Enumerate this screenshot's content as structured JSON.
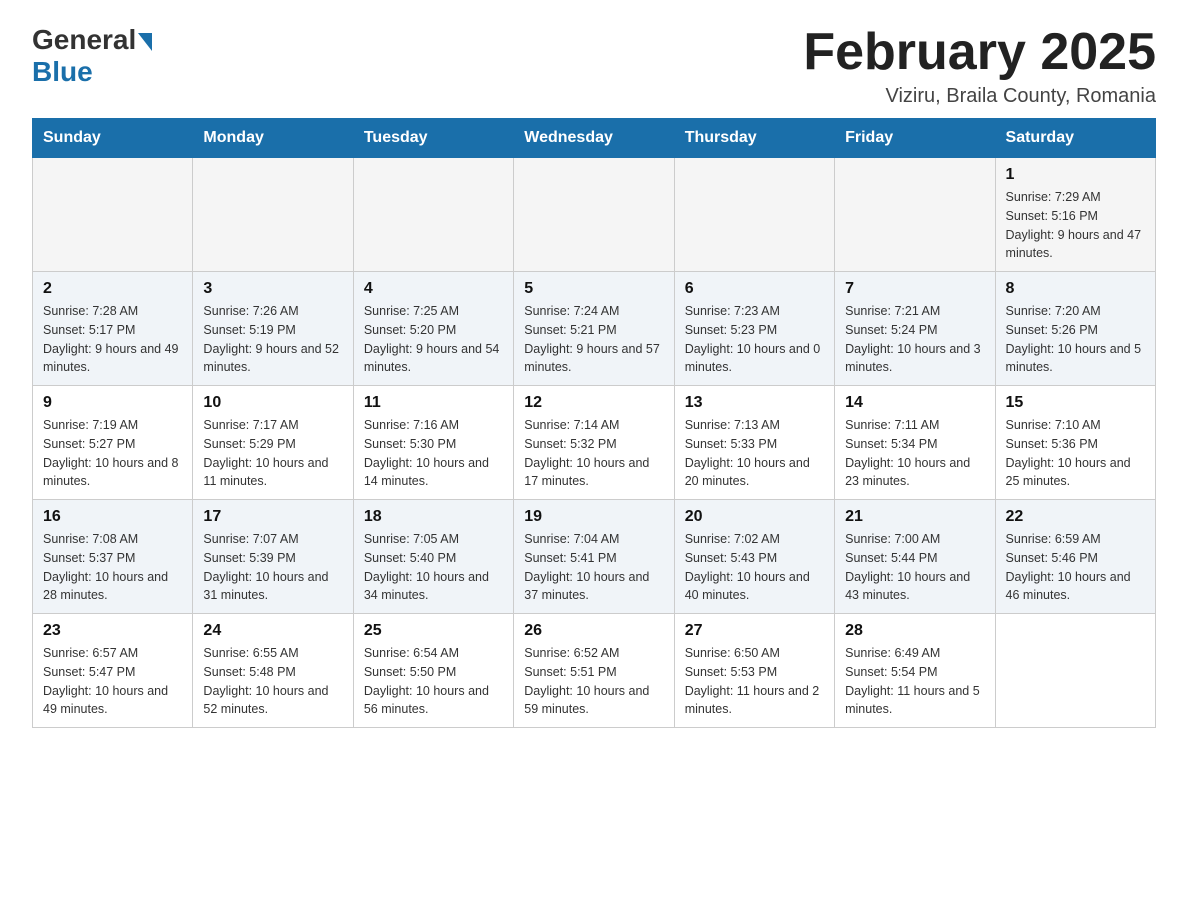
{
  "header": {
    "logo_general": "General",
    "logo_blue": "Blue",
    "title": "February 2025",
    "subtitle": "Viziru, Braila County, Romania"
  },
  "days_of_week": [
    "Sunday",
    "Monday",
    "Tuesday",
    "Wednesday",
    "Thursday",
    "Friday",
    "Saturday"
  ],
  "weeks": [
    [
      {
        "day": "",
        "info": ""
      },
      {
        "day": "",
        "info": ""
      },
      {
        "day": "",
        "info": ""
      },
      {
        "day": "",
        "info": ""
      },
      {
        "day": "",
        "info": ""
      },
      {
        "day": "",
        "info": ""
      },
      {
        "day": "1",
        "info": "Sunrise: 7:29 AM\nSunset: 5:16 PM\nDaylight: 9 hours and 47 minutes."
      }
    ],
    [
      {
        "day": "2",
        "info": "Sunrise: 7:28 AM\nSunset: 5:17 PM\nDaylight: 9 hours and 49 minutes."
      },
      {
        "day": "3",
        "info": "Sunrise: 7:26 AM\nSunset: 5:19 PM\nDaylight: 9 hours and 52 minutes."
      },
      {
        "day": "4",
        "info": "Sunrise: 7:25 AM\nSunset: 5:20 PM\nDaylight: 9 hours and 54 minutes."
      },
      {
        "day": "5",
        "info": "Sunrise: 7:24 AM\nSunset: 5:21 PM\nDaylight: 9 hours and 57 minutes."
      },
      {
        "day": "6",
        "info": "Sunrise: 7:23 AM\nSunset: 5:23 PM\nDaylight: 10 hours and 0 minutes."
      },
      {
        "day": "7",
        "info": "Sunrise: 7:21 AM\nSunset: 5:24 PM\nDaylight: 10 hours and 3 minutes."
      },
      {
        "day": "8",
        "info": "Sunrise: 7:20 AM\nSunset: 5:26 PM\nDaylight: 10 hours and 5 minutes."
      }
    ],
    [
      {
        "day": "9",
        "info": "Sunrise: 7:19 AM\nSunset: 5:27 PM\nDaylight: 10 hours and 8 minutes."
      },
      {
        "day": "10",
        "info": "Sunrise: 7:17 AM\nSunset: 5:29 PM\nDaylight: 10 hours and 11 minutes."
      },
      {
        "day": "11",
        "info": "Sunrise: 7:16 AM\nSunset: 5:30 PM\nDaylight: 10 hours and 14 minutes."
      },
      {
        "day": "12",
        "info": "Sunrise: 7:14 AM\nSunset: 5:32 PM\nDaylight: 10 hours and 17 minutes."
      },
      {
        "day": "13",
        "info": "Sunrise: 7:13 AM\nSunset: 5:33 PM\nDaylight: 10 hours and 20 minutes."
      },
      {
        "day": "14",
        "info": "Sunrise: 7:11 AM\nSunset: 5:34 PM\nDaylight: 10 hours and 23 minutes."
      },
      {
        "day": "15",
        "info": "Sunrise: 7:10 AM\nSunset: 5:36 PM\nDaylight: 10 hours and 25 minutes."
      }
    ],
    [
      {
        "day": "16",
        "info": "Sunrise: 7:08 AM\nSunset: 5:37 PM\nDaylight: 10 hours and 28 minutes."
      },
      {
        "day": "17",
        "info": "Sunrise: 7:07 AM\nSunset: 5:39 PM\nDaylight: 10 hours and 31 minutes."
      },
      {
        "day": "18",
        "info": "Sunrise: 7:05 AM\nSunset: 5:40 PM\nDaylight: 10 hours and 34 minutes."
      },
      {
        "day": "19",
        "info": "Sunrise: 7:04 AM\nSunset: 5:41 PM\nDaylight: 10 hours and 37 minutes."
      },
      {
        "day": "20",
        "info": "Sunrise: 7:02 AM\nSunset: 5:43 PM\nDaylight: 10 hours and 40 minutes."
      },
      {
        "day": "21",
        "info": "Sunrise: 7:00 AM\nSunset: 5:44 PM\nDaylight: 10 hours and 43 minutes."
      },
      {
        "day": "22",
        "info": "Sunrise: 6:59 AM\nSunset: 5:46 PM\nDaylight: 10 hours and 46 minutes."
      }
    ],
    [
      {
        "day": "23",
        "info": "Sunrise: 6:57 AM\nSunset: 5:47 PM\nDaylight: 10 hours and 49 minutes."
      },
      {
        "day": "24",
        "info": "Sunrise: 6:55 AM\nSunset: 5:48 PM\nDaylight: 10 hours and 52 minutes."
      },
      {
        "day": "25",
        "info": "Sunrise: 6:54 AM\nSunset: 5:50 PM\nDaylight: 10 hours and 56 minutes."
      },
      {
        "day": "26",
        "info": "Sunrise: 6:52 AM\nSunset: 5:51 PM\nDaylight: 10 hours and 59 minutes."
      },
      {
        "day": "27",
        "info": "Sunrise: 6:50 AM\nSunset: 5:53 PM\nDaylight: 11 hours and 2 minutes."
      },
      {
        "day": "28",
        "info": "Sunrise: 6:49 AM\nSunset: 5:54 PM\nDaylight: 11 hours and 5 minutes."
      },
      {
        "day": "",
        "info": ""
      }
    ]
  ]
}
